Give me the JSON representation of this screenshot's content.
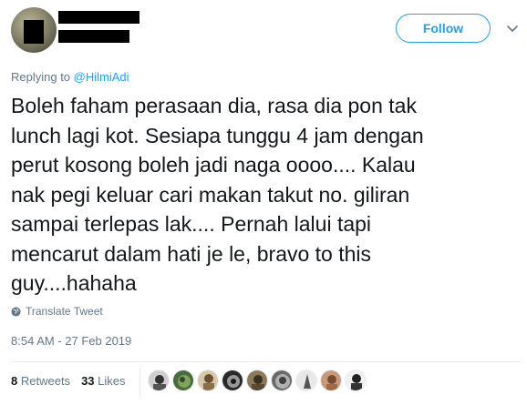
{
  "header": {
    "follow_label": "Follow"
  },
  "reply": {
    "prefix": "Replying to ",
    "mention": "@HilmiAdi"
  },
  "tweet": {
    "text": "Boleh faham perasaan dia, rasa dia pon tak\nlunch lagi kot. Sesiapa tunggu 4 jam dengan\nperut kosong boleh jadi naga oooo.... Kalau\nnak pegi keluar cari makan takut no. giliran\nsampai terlepas lak.... Pernah lalui tapi\nmencarut dalam hati je le, bravo to this\nguy....hahaha",
    "translate_label": "Translate Tweet",
    "timestamp": "8:54 AM - 27 Feb 2019"
  },
  "stats": {
    "retweets_count": "8",
    "retweets_label": "Retweets",
    "likes_count": "33",
    "likes_label": "Likes"
  },
  "colors": {
    "accent": "#1da1f2",
    "muted": "#657786",
    "text": "#14171a"
  }
}
